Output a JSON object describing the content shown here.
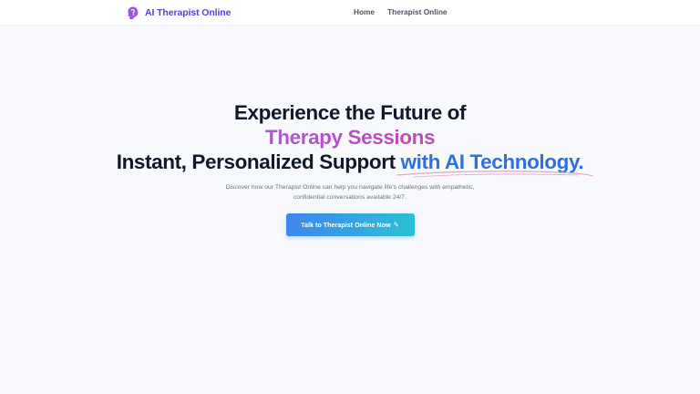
{
  "nav": {
    "brand_name": "AI Therapist Online",
    "brand_icon": "head-profile-icon",
    "links": [
      "Home",
      "Therapist Online"
    ]
  },
  "hero": {
    "line1": "Experience the Future of",
    "line2": "Therapy Sessions",
    "line3_plain": "Instant, Personalized Support ",
    "line3_accent": "with AI Technology.",
    "subtitle": "Discover how our Therapist Online can help you navigate life's challenges with empathetic, confidential conversations available 24/7.",
    "cta_label": "Talk to Therapist Online Now",
    "cta_icon": "✎"
  },
  "colors": {
    "brand": "#5b3fd8",
    "accent": "#2f6fe0",
    "gradient_start": "#8b7fe8",
    "gradient_end": "#e0457b",
    "cta_start": "#3f86ea",
    "cta_end": "#2bbfd4"
  }
}
